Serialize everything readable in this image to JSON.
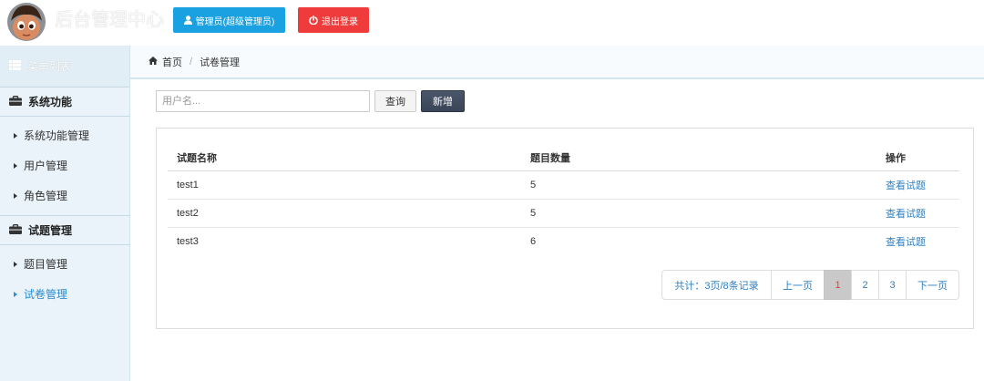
{
  "header": {
    "title": "后台管理中心",
    "user_button_label": "管理员(超级管理员)",
    "logout_button_label": "退出登录"
  },
  "sidebar": {
    "title": "菜单列表",
    "sections": [
      {
        "label": "系统功能",
        "items": [
          {
            "label": "系统功能管理"
          },
          {
            "label": "用户管理"
          },
          {
            "label": "角色管理"
          }
        ]
      },
      {
        "label": "试题管理",
        "items": [
          {
            "label": "题目管理"
          },
          {
            "label": "试卷管理",
            "active": true
          }
        ]
      }
    ]
  },
  "breadcrumb": {
    "home": "首页",
    "separator": "/",
    "current": "试卷管理"
  },
  "toolbar": {
    "search_placeholder": "用户名...",
    "search_value": "",
    "query_label": "查询",
    "add_label": "新增"
  },
  "table": {
    "columns": [
      "试题名称",
      "题目数量",
      "操作"
    ],
    "rows": [
      [
        "test1",
        "5",
        "查看试题"
      ],
      [
        "test2",
        "5",
        "查看试题"
      ],
      [
        "test3",
        "6",
        "查看试题"
      ]
    ]
  },
  "pagination": {
    "summary": "共计：3页/8条记录",
    "prev": "上一页",
    "pages": [
      {
        "label": "1",
        "active": true
      },
      {
        "label": "2"
      },
      {
        "label": "3"
      }
    ],
    "next": "下一页"
  },
  "icons": {
    "avatar": "cartoon-avatar",
    "user_button": "user-icon",
    "logout_button": "power-icon",
    "menu_title": "list-icon",
    "section": "briefcase-icon",
    "menu_item": "caret-right-icon",
    "breadcrumb_home": "home-icon"
  },
  "colors": {
    "accent": "#1aa1e1",
    "danger": "#ef3b3b",
    "link": "#2f7fc1",
    "active_menu": "#2a8cd1",
    "sidebar_bg": "#eaf3f9",
    "dark_button": "#3a4558",
    "page_active_bg": "#c9c9c9",
    "page_active_text": "#e23c3c"
  }
}
